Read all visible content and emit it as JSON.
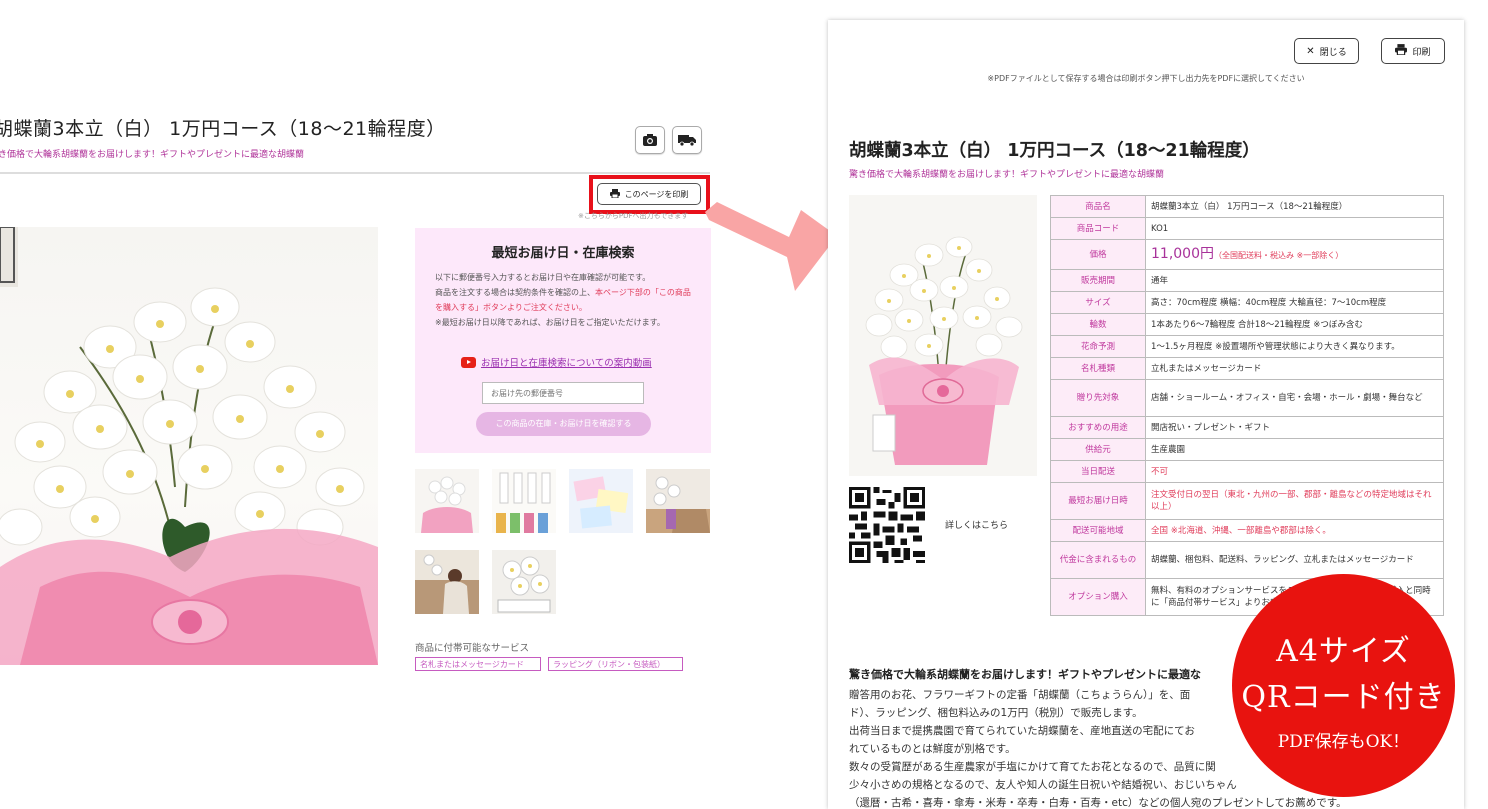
{
  "left": {
    "title": "胡蝶蘭3本立（白） 1万円コース（18〜21輪程度）",
    "subtitle": "き価格で大輪系胡蝶蘭をお届けします！ギフトやプレゼントに最適な胡蝶蘭",
    "icons": [
      "camera-icon",
      "truck-icon"
    ],
    "print_button": "このページを印刷",
    "print_note": "※こちらからPDFへ出力もできます",
    "search": {
      "title": "最短お届け日・在庫検索",
      "text1": "以下に郵便番号入力するとお届け日や在庫確認が可能です。",
      "text2": "商品を注文する場合は契約条件を確認の上、",
      "text2_red": "本ページ下部の「この商品を購入する」ボタンよりご注文ください。",
      "text3": "※最短お届け日以降であれば、お届け日をご指定いただけます。",
      "video_link": "お届け日と在庫検索についての案内動画",
      "zip_placeholder": "お届け先の郵便番号",
      "submit_label": "この商品の在庫・お届け日を確認する"
    },
    "services_label": "商品に付帯可能なサービス",
    "service_tags": [
      "名札またはメッセージカード",
      "ラッピング（リボン・包装紙）"
    ]
  },
  "right": {
    "close_label": "閉じる",
    "print_label": "印刷",
    "note": "※PDFファイルとして保存する場合は印刷ボタン押下し出力先をPDFに選択してください",
    "title": "胡蝶蘭3本立（白） 1万円コース（18〜21輪程度）",
    "subtitle": "驚き価格で大輪系胡蝶蘭をお届けします！ギフトやプレゼントに最適な胡蝶蘭",
    "qr_label": "詳しくはこちら",
    "specs": [
      {
        "k": "商品名",
        "v": "胡蝶蘭3本立（白） 1万円コース（18〜21輪程度）"
      },
      {
        "k": "商品コード",
        "v": "KO1"
      },
      {
        "k": "価格",
        "v": "11,000円",
        "note": "（全国配送料・税込み ※一部除く）"
      },
      {
        "k": "販売期間",
        "v": "通年"
      },
      {
        "k": "サイズ",
        "v": "高さ：70cm程度 横幅：40cm程度 大輪直径：7〜10cm程度"
      },
      {
        "k": "輪数",
        "v": "1本あたり6〜7輪程度 合計18〜21輪程度 ※つぼみ含む"
      },
      {
        "k": "花命予測",
        "v": "1〜1.5ヶ月程度 ※設置場所や管理状態により大きく異なります。"
      },
      {
        "k": "名札種類",
        "v": "立札またはメッセージカード"
      },
      {
        "k": "贈り先対象",
        "v": "店舗・ショールーム・オフィス・自宅・会場・ホール・劇場・舞台など"
      },
      {
        "k": "おすすめの用途",
        "v": "開店祝い・プレゼント・ギフト"
      },
      {
        "k": "供給元",
        "v": "生産農園"
      },
      {
        "k": "当日配送",
        "v": "不可"
      },
      {
        "k": "最短お届け日時",
        "v": "注文受付日の翌日（東北・九州の一部、郡部・離島などの特定地域はそれ以上）"
      },
      {
        "k": "配送可能地域",
        "v": "全国 ※北海道、沖縄、一部離島や郡部は除く。"
      },
      {
        "k": "代金に含まれるもの",
        "v": "胡蝶蘭、梱包料、配送料、ラッピング、立札またはメッセージカード"
      },
      {
        "k": "オプション購入",
        "v": "無料、有料のオプションサービスをご利用いただけます。商品購入と同時に「商品付帯サービス」よりお申し込みください。"
      }
    ],
    "desc_title": "驚き価格で大輪系胡蝶蘭をお届けします！ギフトやプレゼントに最適な",
    "desc_lines": [
      "贈答用のお花、フラワーギフトの定番「胡蝶蘭（こちょうらん）」を、面",
      "ド）、ラッピング、梱包料込みの1万円（税別）で販売します。",
      "出荷当日まで提携農園で育てられていた胡蝶蘭を、産地直送の宅配にてお",
      "れているものとは鮮度が別格です。",
      "数々の受賞歴がある生産農家が手塩にかけて育てたお花となるので、品質に関",
      "少々小さめの規格となるので、友人や知人の誕生日祝いや結婚祝い、おじいちゃん",
      "（還暦・古希・喜寿・傘寿・米寿・卒寿・白寿・百寿・etc）などの個人宛のプレゼントしてお薦めです。"
    ]
  },
  "badge": {
    "line1": "A4サイズ",
    "line2": "QRコード付き",
    "line3": "PDF保存もOK！"
  },
  "colors": {
    "accent_pink": "#b0359a",
    "highlight_red": "#e8101a",
    "badge_red": "#e8130f",
    "search_bg": "#fde8fa"
  }
}
